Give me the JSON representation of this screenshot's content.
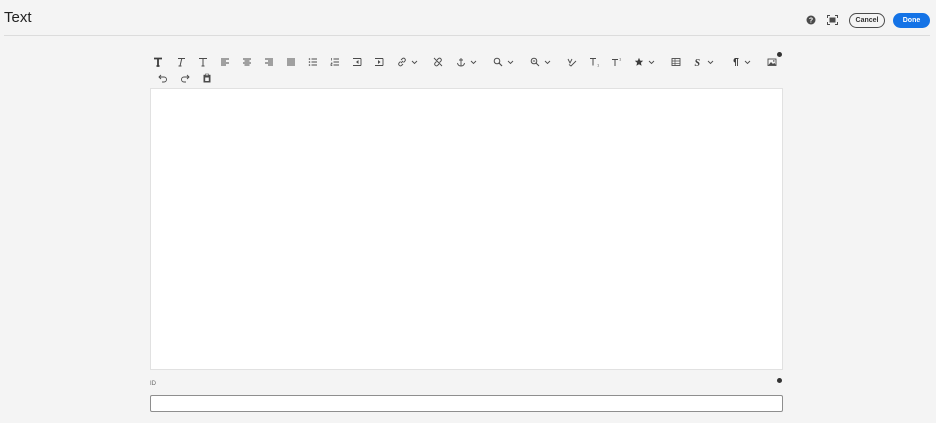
{
  "header": {
    "title": "Text",
    "cancel_label": "Cancel",
    "done_label": "Done",
    "help_icon": "help-circle-icon",
    "fullscreen_icon": "fullscreen-icon"
  },
  "toolbar": {
    "row1": [
      "bold-icon",
      "italic-icon",
      "underline-icon",
      "align-left-icon",
      "align-center-icon",
      "align-right-icon",
      "align-justify-icon",
      "bullet-list-icon",
      "numbered-list-icon",
      "outdent-icon",
      "indent-icon",
      "link-icon",
      "unlink-icon",
      "anchor-icon",
      "find-icon",
      "find-replace-icon",
      "spellcheck-icon",
      "subscript-icon",
      "superscript-icon",
      "special-char-icon",
      "table-icon",
      "styles-icon",
      "paragraph-format-icon",
      "image-icon"
    ],
    "row2": [
      "undo-icon",
      "redo-icon",
      "paste-icon"
    ]
  },
  "field": {
    "id_label": "ID",
    "id_value": "",
    "id_placeholder": ""
  },
  "colors": {
    "accent": "#1473e6",
    "background": "#f4f4f4",
    "editor": "#ffffff",
    "icon": "#4b4b4b"
  }
}
